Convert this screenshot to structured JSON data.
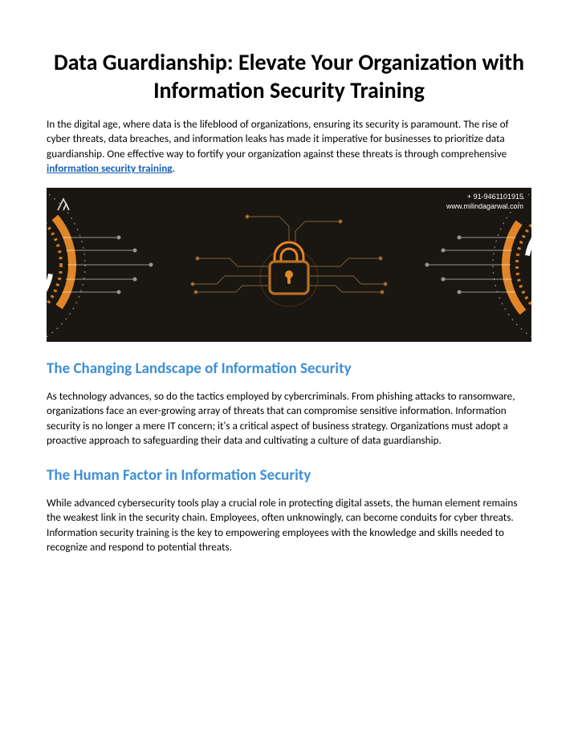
{
  "title": "Data Guardianship: Elevate Your Organization with Information Security Training",
  "intro_pre": "In the digital age, where data is the lifeblood of organizations, ensuring its security is paramount. The rise of cyber threats, data breaches, and information leaks has made it imperative for businesses to prioritize data guardianship. One effective way to fortify your organization against these threats is through comprehensive ",
  "intro_link": "information security training",
  "intro_post": ".",
  "hero": {
    "phone": "+ 91-9461101915",
    "site": "www.milindagarwal.com",
    "accent_orange": "#e08628",
    "accent_white": "#ffffff",
    "bg": "#1a1611"
  },
  "sections": [
    {
      "heading": "The Changing Landscape of Information Security",
      "body": "As technology advances, so do the tactics employed by cybercriminals. From phishing attacks to ransomware, organizations face an ever-growing array of threats that can compromise sensitive information. Information security is no longer a mere IT concern; it's a critical aspect of business strategy. Organizations must adopt a proactive approach to safeguarding their data and cultivating a culture of data guardianship."
    },
    {
      "heading": "The Human Factor in Information Security",
      "body": "While advanced cybersecurity tools play a crucial role in protecting digital assets, the human element remains the weakest link in the security chain. Employees, often unknowingly, can become conduits for cyber threats. Information security training is the key to empowering employees with the knowledge and skills needed to recognize and respond to potential threats."
    }
  ]
}
